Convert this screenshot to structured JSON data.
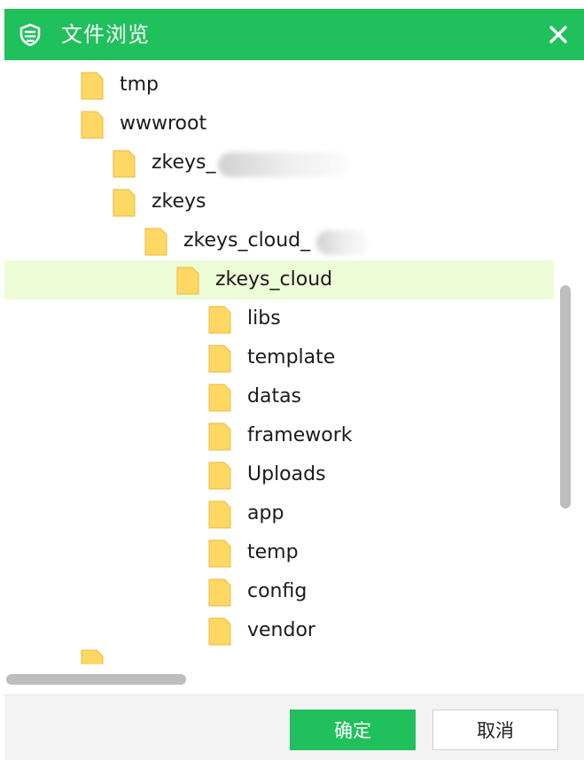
{
  "window": {
    "title": "文件浏览",
    "accent_color": "#20c05c",
    "selected_row_color": "#edfbd6",
    "folder_color": "#ffd863"
  },
  "tree": {
    "items": [
      {
        "label": "tmp",
        "depth": 0
      },
      {
        "label": "wwwroot",
        "depth": 0
      },
      {
        "label": "zkeys_",
        "depth": 1,
        "redacted_suffix": true
      },
      {
        "label": "zkeys",
        "depth": 1
      },
      {
        "label": "zkeys_cloud_",
        "depth": 2,
        "redacted_suffix": true
      },
      {
        "label": "zkeys_cloud",
        "depth": 3,
        "selected": true
      },
      {
        "label": "libs",
        "depth": 4
      },
      {
        "label": "template",
        "depth": 4
      },
      {
        "label": "datas",
        "depth": 4
      },
      {
        "label": "framework",
        "depth": 4
      },
      {
        "label": "Uploads",
        "depth": 4
      },
      {
        "label": "app",
        "depth": 4
      },
      {
        "label": "temp",
        "depth": 4
      },
      {
        "label": "config",
        "depth": 4
      },
      {
        "label": "vendor",
        "depth": 4
      },
      {
        "label": "",
        "depth": 0,
        "partially_visible": true
      }
    ]
  },
  "footer": {
    "ok_label": "确定",
    "cancel_label": "取消"
  }
}
